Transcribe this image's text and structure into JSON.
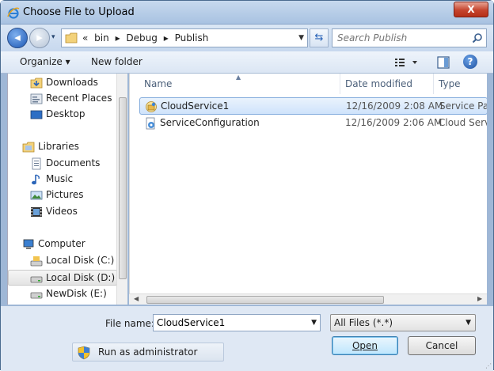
{
  "window": {
    "title": "Choose File to Upload",
    "close_label": "X"
  },
  "address": {
    "prefix": "«",
    "path": [
      "bin",
      "Debug",
      "Publish"
    ],
    "separator": "▸"
  },
  "search": {
    "placeholder": "Search Publish"
  },
  "toolbar": {
    "organize_label": "Organize ▾",
    "new_folder_label": "New folder"
  },
  "nav": {
    "favorites": [
      "Downloads",
      "Recent Places",
      "Desktop"
    ],
    "libraries_label": "Libraries",
    "libraries": [
      "Documents",
      "Music",
      "Pictures",
      "Videos"
    ],
    "computer_label": "Computer",
    "drives": [
      "Local Disk (C:)",
      "Local Disk (D:)",
      "NewDisk (E:)"
    ],
    "selected": "Local Disk (D:)"
  },
  "columns": {
    "name": "Name",
    "date": "Date modified",
    "type": "Type"
  },
  "files": [
    {
      "name": "CloudService1",
      "date": "12/16/2009 2:08 AM",
      "type": "Service Pack",
      "selected": true
    },
    {
      "name": "ServiceConfiguration",
      "date": "12/16/2009 2:06 AM",
      "type": "Cloud Servic",
      "selected": false
    }
  ],
  "bottom": {
    "file_name_label": "File name:",
    "file_name_value": "CloudService1",
    "filter_value": "All Files (*.*)",
    "run_as_label": "Run as administrator",
    "open_label": "Open",
    "cancel_label": "Cancel"
  },
  "colors": {
    "accent": "#1d4f9e",
    "selection": "#cfe3fb",
    "window_frame": "#9fb7d6"
  }
}
